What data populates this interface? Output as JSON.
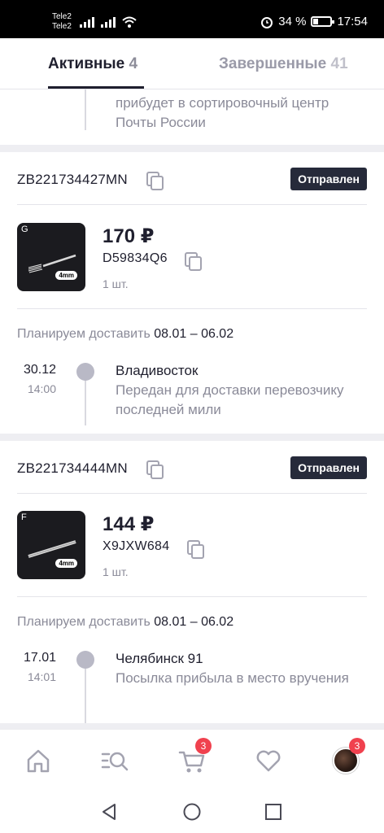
{
  "status_bar": {
    "carrier_1": "Tele2",
    "carrier_2": "Tele2",
    "battery": "34 %",
    "time": "17:54"
  },
  "tabs": {
    "active": {
      "label": "Активные",
      "count": "4"
    },
    "completed": {
      "label": "Завершенные",
      "count": "41"
    }
  },
  "previous_card_fragment": {
    "text": "прибудет в сортировочный центр Почты России"
  },
  "shipments": [
    {
      "tracking": "ZB221734427MN",
      "status": "Отправлен",
      "thumb_letter": "G",
      "thumb_label": "4mm",
      "price": "170 ₽",
      "sku": "D59834Q6",
      "quantity": "1 шт.",
      "plan_prefix": "Планируем доставить",
      "plan_range": "08.01 – 06.02",
      "event": {
        "date": "30.12",
        "time": "14:00",
        "city": "Владивосток",
        "description": "Передан для доставки перевозчику последней мили"
      }
    },
    {
      "tracking": "ZB221734444MN",
      "status": "Отправлен",
      "thumb_letter": "F",
      "thumb_label": "4mm",
      "price": "144 ₽",
      "sku": "X9JXW684",
      "quantity": "1 шт.",
      "plan_prefix": "Планируем доставить",
      "plan_range": "08.01 – 06.02",
      "event": {
        "date": "17.01",
        "time": "14:01",
        "city": "Челябинск 91",
        "description": "Посылка прибыла в место вручения"
      }
    }
  ],
  "bottom_nav": {
    "items": [
      "home-icon",
      "catalog-search-icon",
      "cart-icon",
      "heart-icon",
      "profile-avatar"
    ],
    "cart_badge": "3",
    "profile_badge": "3"
  },
  "colors": {
    "badge_bg": "#262a3a",
    "notify_red": "#f0414e",
    "muted_text": "#8a8a98",
    "page_bg": "#eeeef2"
  }
}
